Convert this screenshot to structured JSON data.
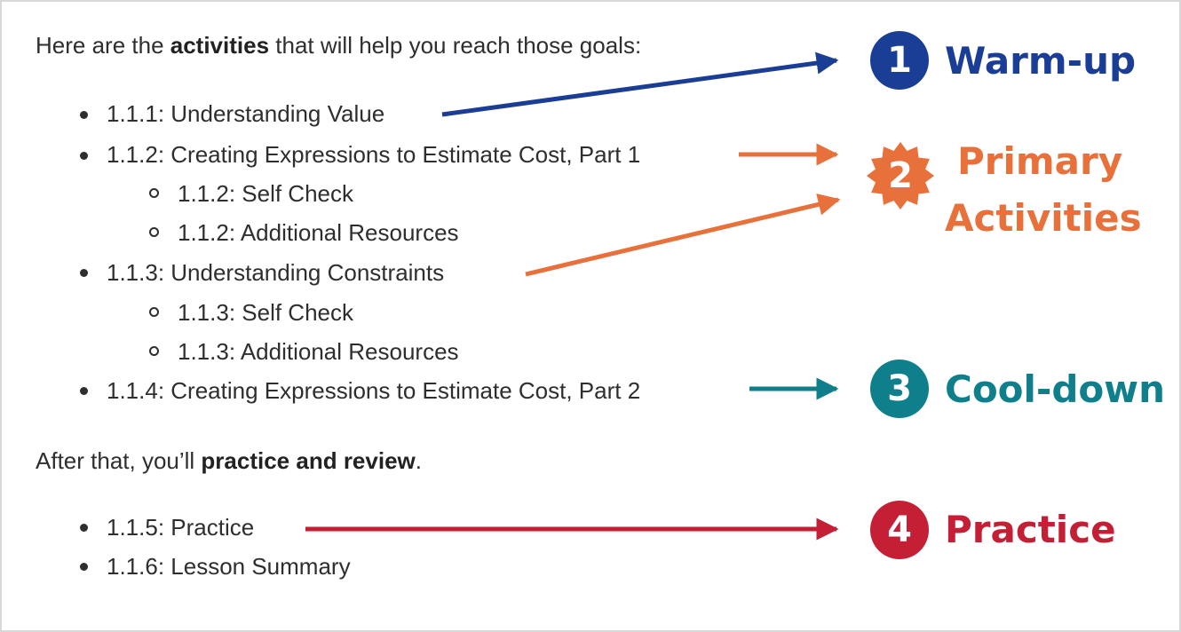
{
  "colors": {
    "warmup": "#1a3d96",
    "primary": "#e8703a",
    "cooldown": "#0f7f8c",
    "practice": "#c41f35",
    "text": "#2e2e2e"
  },
  "intro": {
    "prefix": "Here are the ",
    "bold": "activities",
    "suffix": " that will help you reach those goals:"
  },
  "activities": {
    "item_1_1_1": "1.1.1: Understanding Value",
    "item_1_1_2": "1.1.2: Creating Expressions to Estimate Cost, Part 1",
    "item_1_1_2_self_check": "1.1.2: Self Check",
    "item_1_1_2_resources": "1.1.2: Additional Resources",
    "item_1_1_3": "1.1.3: Understanding Constraints",
    "item_1_1_3_self_check": "1.1.3: Self Check",
    "item_1_1_3_resources": "1.1.3: Additional Resources",
    "item_1_1_4": "1.1.4: Creating Expressions to Estimate Cost, Part 2"
  },
  "after": {
    "prefix": "After that, you’ll ",
    "bold": "practice and review",
    "suffix": "."
  },
  "practice_items": {
    "item_1_1_5": "1.1.5: Practice",
    "item_1_1_6": "1.1.6: Lesson Summary"
  },
  "callouts": {
    "warmup": {
      "number": "1",
      "label": "Warm-up",
      "icon": "circle-badge"
    },
    "primary": {
      "number": "2",
      "label_line1": "Primary",
      "label_line2": "Activities",
      "icon": "starburst-badge"
    },
    "cooldown": {
      "number": "3",
      "label": "Cool-down",
      "icon": "circle-badge"
    },
    "practice": {
      "number": "4",
      "label": "Practice",
      "icon": "circle-badge"
    }
  }
}
